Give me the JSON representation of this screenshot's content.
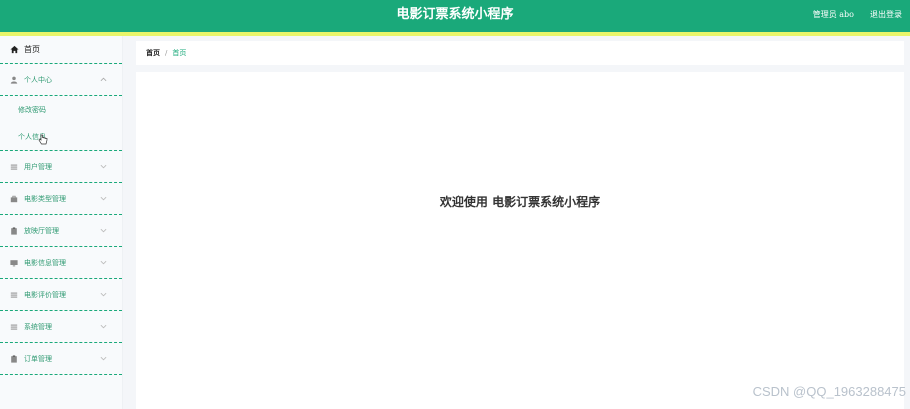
{
  "header": {
    "title": "电影订票系统小程序",
    "user": "管理员 abo",
    "logout": "退出登录"
  },
  "colors": {
    "primary": "#1aa97a",
    "accent": "#e8f56a"
  },
  "sidebar": {
    "home": {
      "label": "首页",
      "icon": "home-icon"
    },
    "personal": {
      "label": "个人中心",
      "icon": "user-icon",
      "expanded": true,
      "children": [
        "修改密码",
        "个人信息"
      ]
    },
    "items": [
      {
        "label": "用户管理",
        "icon": "list-icon"
      },
      {
        "label": "电影类型管理",
        "icon": "briefcase-icon"
      },
      {
        "label": "放映厅管理",
        "icon": "clipboard-icon"
      },
      {
        "label": "电影信息管理",
        "icon": "monitor-icon"
      },
      {
        "label": "电影评价管理",
        "icon": "list-icon"
      },
      {
        "label": "系统管理",
        "icon": "list-icon"
      },
      {
        "label": "订单管理",
        "icon": "clipboard-icon"
      }
    ]
  },
  "breadcrumb": {
    "home": "首页",
    "separator": "/",
    "current": "首页"
  },
  "main": {
    "welcome": "欢迎使用 电影订票系统小程序"
  },
  "watermark": "CSDN @QQ_1963288475"
}
